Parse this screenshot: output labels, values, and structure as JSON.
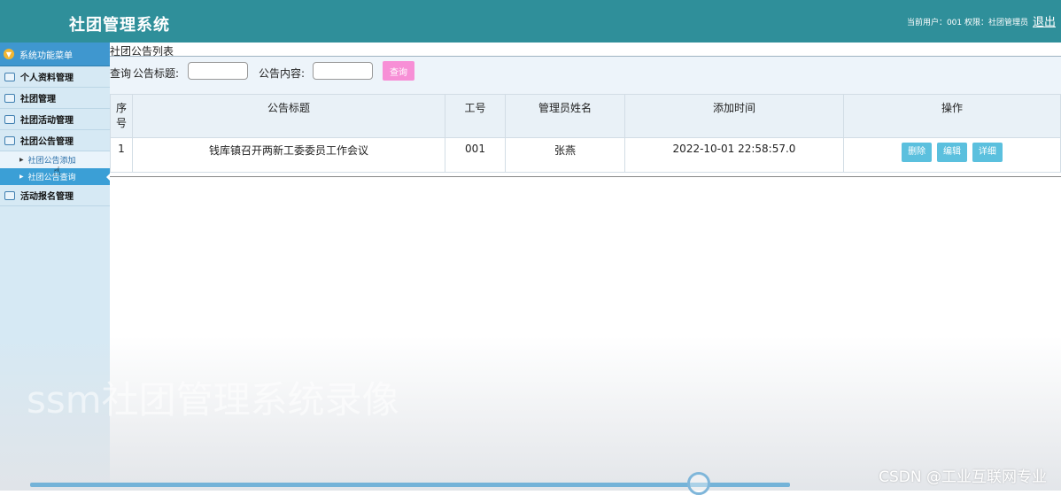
{
  "header": {
    "title": "社团管理系统",
    "user_info": "当前用户：001  权限：社团管理员",
    "logout": "退出"
  },
  "sidebar": {
    "menu_title": "系统功能菜单",
    "items": [
      {
        "label": "个人资料管理"
      },
      {
        "label": "社团管理"
      },
      {
        "label": "社团活动管理"
      },
      {
        "label": "社团公告管理"
      },
      {
        "label": "活动报名管理"
      }
    ],
    "sub_items": [
      {
        "label": "社团公告添加"
      },
      {
        "label": "社团公告查询"
      }
    ]
  },
  "main": {
    "section_title": "社团公告列表",
    "search": {
      "query_label": "查询",
      "title_label": "公告标题:",
      "content_label": "公告内容:",
      "button": "查询"
    },
    "table": {
      "headers": [
        "序号",
        "公告标题",
        "工号",
        "管理员姓名",
        "添加时间",
        "操作"
      ],
      "rows": [
        {
          "index": "1",
          "title": "钱库镇召开两新工委委员工作会议",
          "staff_id": "001",
          "admin_name": "张燕",
          "added_time": "2022-10-01 22:58:57.0"
        }
      ],
      "actions": [
        "删除",
        "编辑",
        "详细"
      ]
    }
  },
  "overlay": {
    "watermark": "ssm社团管理系统录像",
    "csdn": "CSDN @工业互联网专业"
  },
  "video_progress": 0.88
}
